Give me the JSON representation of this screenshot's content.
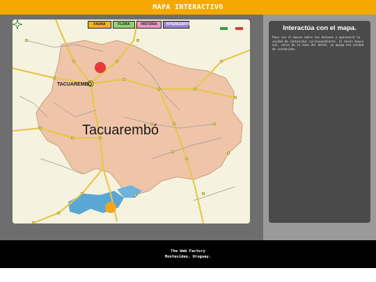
{
  "header": {
    "title": "MAPA INTERACTIVO"
  },
  "map": {
    "categories": [
      {
        "label": "FAUNA",
        "color": "#f3b11a"
      },
      {
        "label": "FLORA",
        "color": "#8fd16f"
      },
      {
        "label": "HISTORIA",
        "color": "#ee98c6"
      },
      {
        "label": "INTERESANTE",
        "color": "#9a85d1"
      }
    ],
    "city_label": "TACUAREMBÓ",
    "department_label": "Tacuarembó",
    "hotspots": [
      {
        "color": "#e8383a"
      },
      {
        "color": "#f3a51e"
      }
    ]
  },
  "info": {
    "title": "Interactúa con el mapa.",
    "body": "Pase con el mouse sobre los botones y aparecerá la unidad de contenidos correspondiente. Si haces mouse out, sales de la zona del botón, se apaga esa unidad de contenidos."
  },
  "footer": {
    "line1": "The Web Factory",
    "line2": "Montevideo, Uruguay."
  },
  "colors": {
    "header": "#f4a800",
    "panel_left": "#6e6e6e",
    "panel_right": "#9a9a9a",
    "info_box": "#4a4a4a",
    "footer": "#000000",
    "region_fill": "#efc4a8",
    "water": "#5aa7d6"
  }
}
